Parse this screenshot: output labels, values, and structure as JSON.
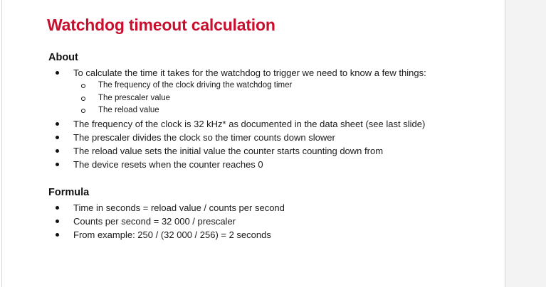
{
  "title": "Watchdog timeout calculation",
  "about": {
    "heading": "About",
    "intro": "To calculate the time it takes for the watchdog to trigger we need to know a few things:",
    "subitems": [
      "The frequency of the clock driving the watchdog timer",
      "The prescaler value",
      "The reload value"
    ],
    "items": [
      "The frequency of the clock is 32 kHz* as documented in the data sheet (see last slide)",
      "The prescaler divides the clock so the timer counts down slower",
      "The reload value sets the initial value the counter starts counting down from",
      "The device resets when the counter reaches 0"
    ]
  },
  "formula": {
    "heading": "Formula",
    "items": [
      "Time in seconds = reload value / counts per second",
      "Counts per second = 32 000 / prescaler",
      "From example: 250 / (32 000 / 256) = 2 seconds"
    ]
  },
  "colors": {
    "title": "#c8102e",
    "text": "#1a1a1a"
  }
}
